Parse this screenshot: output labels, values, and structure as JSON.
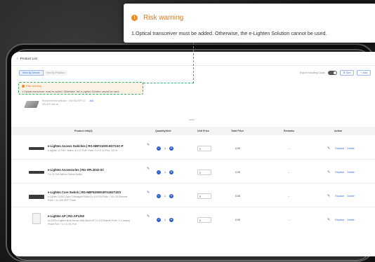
{
  "popup": {
    "title": "Risk warning",
    "message": "1.Optical transceiver must be added. Otherwise, the e-Lighten Solution cannot be used."
  },
  "header": {
    "title": "Product List",
    "back_icon": "chevron-left-icon"
  },
  "toolbar": {
    "view_tabs": [
      {
        "label": "View by Device",
        "active": true
      },
      {
        "label": "View by Position",
        "active": false
      }
    ],
    "export_label": "Export Including Costs",
    "sort_label": "Sort",
    "add_label": "Add"
  },
  "warning": {
    "title": "Risk warning",
    "message": "1.Optical transceiver must be added. Otherwise, the e-Lighten Solution cannot be used."
  },
  "recommendation": {
    "line1": "Recommended selection：EW-SW-SFP-10",
    "line2": "EW-SFP-MM  x5",
    "add_label": "Add"
  },
  "collapse_label": "Less ⌃",
  "table": {
    "headers": [
      "Product Info(4)",
      "Quantity/Unit",
      "Unit Price",
      "Total Price",
      "Remarks",
      "Action"
    ],
    "rows": [
      {
        "name": "e-Lighten Access Switches | RG-NBF2100S-8GT1SC-P",
        "desc": "e-Lighten 10 PoE+ Switch, 8 x 1G PoE+ Ports, 1 x 1G SC Port, 120 W",
        "desc2": "",
        "qty": "1",
        "price": "0",
        "total": "0.00",
        "remark": "--",
        "replace": "Replace",
        "delete": "Delete",
        "image": "switch"
      },
      {
        "name": "e-Lighten Accessories | RG-SPL2032-SC",
        "desc": "1 in 32 Out Uniform Optical Splitter",
        "desc2": "",
        "qty": "1",
        "price": "0",
        "total": "0.00",
        "remark": "--",
        "replace": "Replace",
        "delete": "Delete",
        "image": "switch"
      },
      {
        "name": "e-Lighten Core Switch | RG-NBF5200M-8FS16GT4XS",
        "desc": "e-Lighten 10/100 Layer 3 Managed Switch 8 x 10 PON Ports + 16 x 1G Ethernet",
        "desc2": "Ports + 4 x 10G SFP+ Ports",
        "qty": "1",
        "price": "0",
        "total": "0.00",
        "remark": "--",
        "replace": "Replace",
        "delete": "Delete",
        "image": "switch"
      },
      {
        "name": "e-Lighten AP | RG-AP1250",
        "desc": "AC1200 e-Lighten Multi-Service Wall-Mount AP 2 x 1G Ethernet Ports + 1 x analog",
        "desc2": "Phone Port + 1 x 1G SC Port",
        "qty": "1",
        "price": "0",
        "total": "0.00",
        "remark": "--",
        "replace": "Replace",
        "delete": "Delete",
        "image": "ap"
      }
    ]
  },
  "colors": {
    "accent": "#2d5fd3",
    "warning": "#f08a24",
    "highlight": "#2bb673"
  }
}
